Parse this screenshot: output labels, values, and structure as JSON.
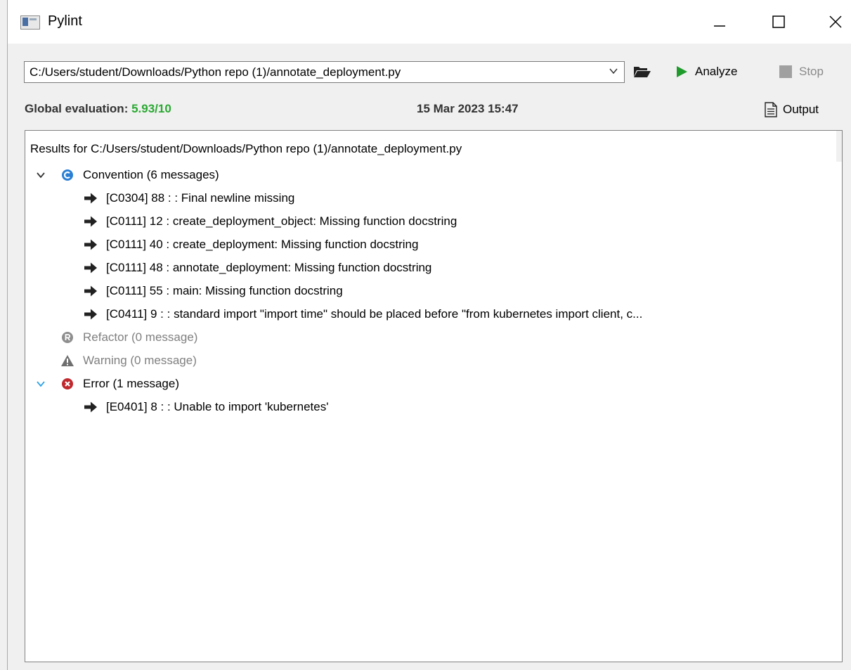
{
  "window": {
    "title": "Pylint"
  },
  "toolbar": {
    "file_path": "C:/Users/student/Downloads/Python repo (1)/annotate_deployment.py",
    "analyze_label": "Analyze",
    "stop_label": "Stop"
  },
  "evaluation": {
    "label": "Global evaluation: ",
    "score": "5.93/10",
    "date": "15 Mar 2023 15:47",
    "output_label": "Output"
  },
  "results": {
    "header": "Results for C:/Users/student/Downloads/Python repo (1)/annotate_deployment.py",
    "convention": {
      "label": "Convention (6 messages)",
      "messages": [
        "[C0304] 88 : : Final newline missing",
        "[C0111] 12 : create_deployment_object: Missing function docstring",
        "[C0111] 40 : create_deployment: Missing function docstring",
        "[C0111] 48 : annotate_deployment: Missing function docstring",
        "[C0111] 55 : main: Missing function docstring",
        "[C0411] 9 : : standard import \"import time\" should be placed before \"from kubernetes import client, c..."
      ]
    },
    "refactor": {
      "label": "Refactor (0 message)"
    },
    "warning": {
      "label": "Warning (0 message)"
    },
    "error": {
      "label": "Error (1 message)",
      "messages": [
        "[E0401] 8 : : Unable to import 'kubernetes'"
      ]
    }
  },
  "colors": {
    "score_green": "#2aa832",
    "convention_blue": "#2a7fd4",
    "error_red": "#c0282d",
    "analyze_green": "#1f9b2c"
  }
}
